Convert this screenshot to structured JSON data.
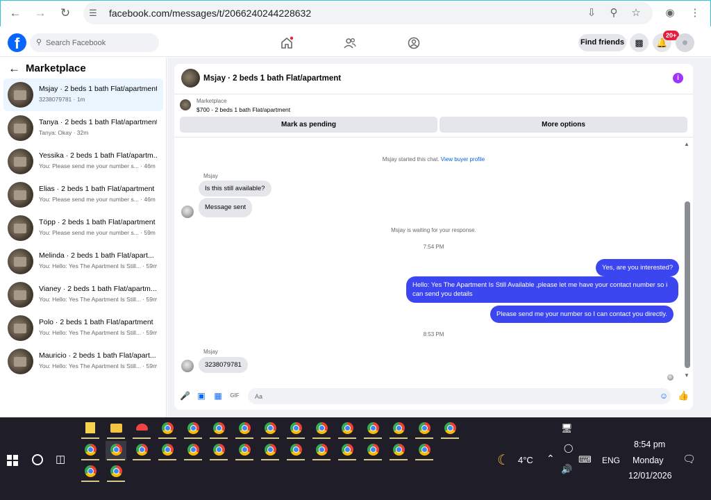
{
  "browser": {
    "url": "facebook.com/messages/t/2066240244228632"
  },
  "fb": {
    "search_placeholder": "Search Facebook",
    "find_friends": "Find friends",
    "notif_badge": "20+"
  },
  "marketplace": {
    "title": "Marketplace",
    "conversations": [
      {
        "title": "Msjay · 2 beds 1 bath Flat/apartment",
        "sub": "3238079781 · 1m",
        "selected": true
      },
      {
        "title": "Tanya · 2 beds 1 bath Flat/apartment",
        "sub": "Tanya: Okay · 32m"
      },
      {
        "title": "Yessika · 2 beds 1 bath Flat/apartm...",
        "sub": "You: Please send me your number s... · 46m"
      },
      {
        "title": "Elias · 2 beds 1 bath Flat/apartment",
        "sub": "You: Please send me your number s... · 46m"
      },
      {
        "title": "Töpp · 2 beds 1 bath Flat/apartment",
        "sub": "You: Please send me your number s... · 59m"
      },
      {
        "title": "Melinda · 2 beds 1 bath Flat/apart...",
        "sub": "You: Hello: Yes The Apartment Is Still... · 59m"
      },
      {
        "title": "Vianey · 2 beds 1 bath Flat/apartm...",
        "sub": "You: Hello: Yes The Apartment Is Still... · 59m"
      },
      {
        "title": "Polo · 2 beds 1 bath Flat/apartment",
        "sub": "You: Hello: Yes The Apartment Is Still... · 59m"
      },
      {
        "title": "Mauricio · 2 beds 1 bath Flat/apart...",
        "sub": "You: Hello: Yes The Apartment Is Still... · 59m"
      }
    ]
  },
  "chat": {
    "title": "Msjay · 2 beds 1 bath Flat/apartment",
    "mp_label": "Marketplace",
    "mp_price": "$700 - 2 beds 1 bath Flat/apartment",
    "btn_pending": "Mark as pending",
    "btn_more": "More options",
    "started": "Msjay started this chat.",
    "view_profile": "View buyer profile",
    "sender1": "Msjay",
    "msg1": "Is this still available?",
    "msg2": "Message sent",
    "waiting": "Msjay is waiting for your response.",
    "time1": "7:54 PM",
    "out1": "Yes, are you interested?",
    "out2": "Hello: Yes The Apartment Is Still Available ,please let me have your contact number so i can send you details",
    "out3": "Please send me your number so I can contact you directly.",
    "time2": "8:53 PM",
    "sender2": "Msjay",
    "msg3": "3238079781",
    "composer_placeholder": "Aa"
  },
  "taskbar": {
    "weather": "4°C",
    "lang": "ENG",
    "time": "8:54 pm",
    "day": "Monday",
    "date": "12/01/2026"
  }
}
